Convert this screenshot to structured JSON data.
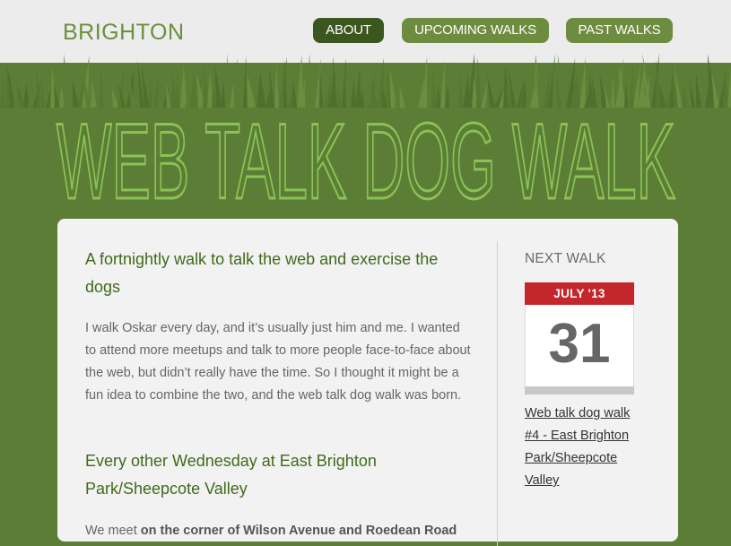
{
  "header": {
    "brand": "BRIGHTON",
    "nav": [
      {
        "label": "ABOUT",
        "active": true
      },
      {
        "label": "UPCOMING WALKS",
        "active": false
      },
      {
        "label": "PAST WALKS",
        "active": false
      }
    ]
  },
  "hero": {
    "title": "WEB TALK DOG WALK"
  },
  "main": {
    "heading_intro": "A fortnightly walk to talk the web and exercise the dogs",
    "paragraph": "I walk Oskar every day, and it’s usually just him and me. I wanted to attend more meetups and talk to more people face-to-face about the web, but didn’t really have the time. So I thought it might be a fun idea to combine the two, and the web talk dog walk was born.",
    "heading_when": "Every other Wednesday at East Brighton Park/Sheepcote Valley",
    "cut_text_start": "We meet ",
    "cut_text_bold": "on the corner of Wilson Avenue and Roedean Road"
  },
  "sidebar": {
    "label": "NEXT WALK",
    "calendar": {
      "month": "JULY '13",
      "day": "31"
    },
    "link": "Web talk dog walk #4 - East Brighton Park/Sheepcote Valley"
  },
  "colors": {
    "grass_green": "#5b7d36",
    "nav_active": "#3c561f",
    "nav_default": "#6d8c3f",
    "heading_green": "#3f6a1a",
    "hero_text": "#8cc255",
    "calendar_red": "#c3272b"
  }
}
